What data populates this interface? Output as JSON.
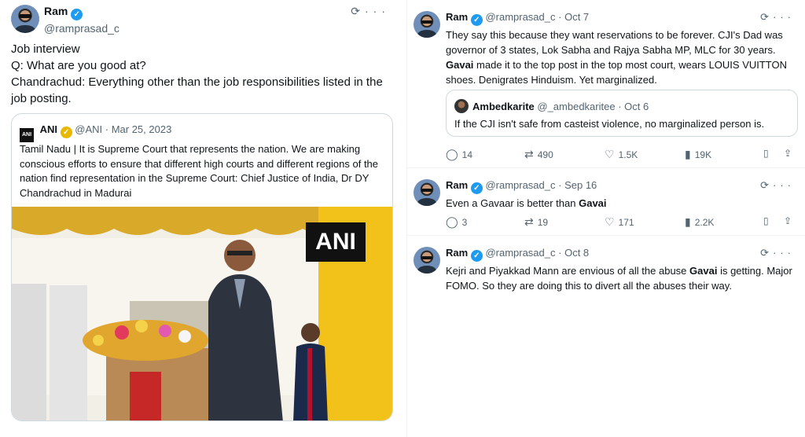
{
  "left": {
    "author": {
      "name": "Ram",
      "handle": "@ramprasad_c"
    },
    "body_lines": [
      "Job interview",
      "Q: What are you good at?",
      "Chandrachud: Everything other than the job responsibilities listed in the job posting."
    ],
    "quote": {
      "logo": "ANI",
      "name": "ANI",
      "handle": "@ANI",
      "date": "· Mar 25, 2023",
      "text": "Tamil Nadu | It is Supreme Court that represents the nation. We are making conscious efforts to ensure that different high courts and different regions of the nation find representation in the Supreme Court: Chief Justice of India, Dr DY Chandrachud in Madurai",
      "watermark": "ANI"
    }
  },
  "tweets": [
    {
      "name": "Ram",
      "handle": "@ramprasad_c",
      "date": "· Oct 7",
      "text_parts": [
        {
          "t": "They say this because they want reservations to be forever. CJI's Dad was governor of 3 states, Lok Sabha and Rajya Sabha MP, MLC for 30 years. ",
          "b": false
        },
        {
          "t": "Gavai",
          "b": true
        },
        {
          "t": " made it to the top post in the top most court,  wears LOUIS VUITTON shoes. Denigrates Hinduism. Yet marginalized.",
          "b": false
        }
      ],
      "quoted": {
        "name": "Ambedkarite",
        "handle": "@_ambedkaritee",
        "date": "· Oct 6",
        "text": "If the CJI isn't safe from casteist violence, no marginalized person is."
      },
      "replies": "14",
      "reposts": "490",
      "likes": "1.5K",
      "views": "19K"
    },
    {
      "name": "Ram",
      "handle": "@ramprasad_c",
      "date": "· Sep 16",
      "text_parts": [
        {
          "t": "Even a Gavaar is better than ",
          "b": false
        },
        {
          "t": "Gavai",
          "b": true
        }
      ],
      "replies": "3",
      "reposts": "19",
      "likes": "171",
      "views": "2.2K"
    },
    {
      "name": "Ram",
      "handle": "@ramprasad_c",
      "date": "· Oct 8",
      "text_parts": [
        {
          "t": "Kejri and Piyakkad Mann are envious of all the abuse ",
          "b": false
        },
        {
          "t": "Gavai",
          "b": true
        },
        {
          "t": " is getting. Major FOMO. So they are doing this to divert all the abuses their way.",
          "b": false
        }
      ]
    }
  ],
  "icons": {
    "grok": "grok-icon",
    "more": "more-icon",
    "reply": "reply-icon",
    "repost": "repost-icon",
    "like": "like-icon",
    "views": "views-icon",
    "bookmark": "bookmark-icon",
    "share": "share-icon"
  },
  "colors": {
    "accent": "#1d9bf0",
    "muted": "#536471",
    "border": "#cfd9de"
  }
}
